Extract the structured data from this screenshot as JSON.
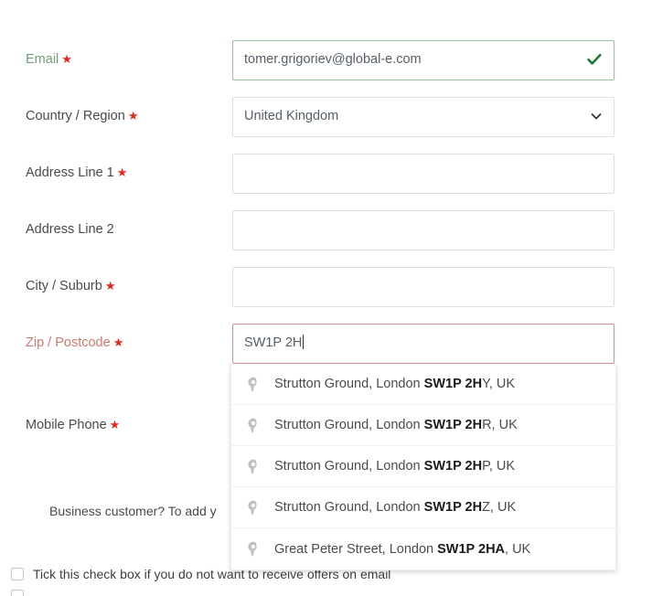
{
  "form": {
    "required_marker": "★",
    "rows": [
      {
        "label": "Email",
        "state": "valid",
        "value": "tomer.grigoriev@global-e.com",
        "placeholder": "",
        "required": true,
        "adornment": "check-icon"
      },
      {
        "label": "Country / Region",
        "state": "default",
        "value": "United Kingdom",
        "placeholder": "",
        "required": true,
        "adornment": "chevron-down-icon"
      },
      {
        "label": "Address Line 1",
        "state": "default",
        "value": "",
        "placeholder": "",
        "required": true,
        "adornment": ""
      },
      {
        "label": "Address Line 2",
        "state": "default",
        "value": "",
        "placeholder": "",
        "required": false,
        "adornment": ""
      },
      {
        "label": "City / Suburb",
        "state": "default",
        "value": "",
        "placeholder": "",
        "required": true,
        "adornment": ""
      },
      {
        "label": "Zip / Postcode",
        "state": "invalid",
        "value": "SW1P 2H",
        "placeholder": "",
        "required": true,
        "adornment": ""
      },
      {
        "label": "Mobile Phone",
        "state": "default",
        "value": "",
        "placeholder": "",
        "required": true,
        "adornment": ""
      }
    ]
  },
  "autocomplete": {
    "icon": "map-pin-icon",
    "query": "SW1P 2H",
    "suggestions": [
      {
        "prefix": "Strutton Ground, London ",
        "match": "SW1P 2H",
        "suffix": "Y, UK"
      },
      {
        "prefix": "Strutton Ground, London ",
        "match": "SW1P 2H",
        "suffix": "R, UK"
      },
      {
        "prefix": "Strutton Ground, London ",
        "match": "SW1P 2H",
        "suffix": "P, UK"
      },
      {
        "prefix": "Strutton Ground, London ",
        "match": "SW1P 2H",
        "suffix": "Z, UK"
      },
      {
        "prefix": "Great Peter Street, London ",
        "match": "SW1P 2HA",
        "suffix": ", UK"
      }
    ]
  },
  "notes": {
    "business_customer": "Business customer? To add y"
  },
  "checkboxes": [
    {
      "label": "Tick this check box if you do not want to receive offers on email",
      "checked": false
    },
    {
      "label": "",
      "checked": false
    }
  ],
  "colors": {
    "required_star": "#e8261c",
    "valid_border": "#9cbf9f",
    "valid_label": "#6f9f77",
    "invalid_border": "#cf9490",
    "invalid_label": "#d2776f",
    "check_icon": "#207a3c",
    "default_border": "#e0e0e0",
    "pin_icon": "#b9b9b9"
  }
}
